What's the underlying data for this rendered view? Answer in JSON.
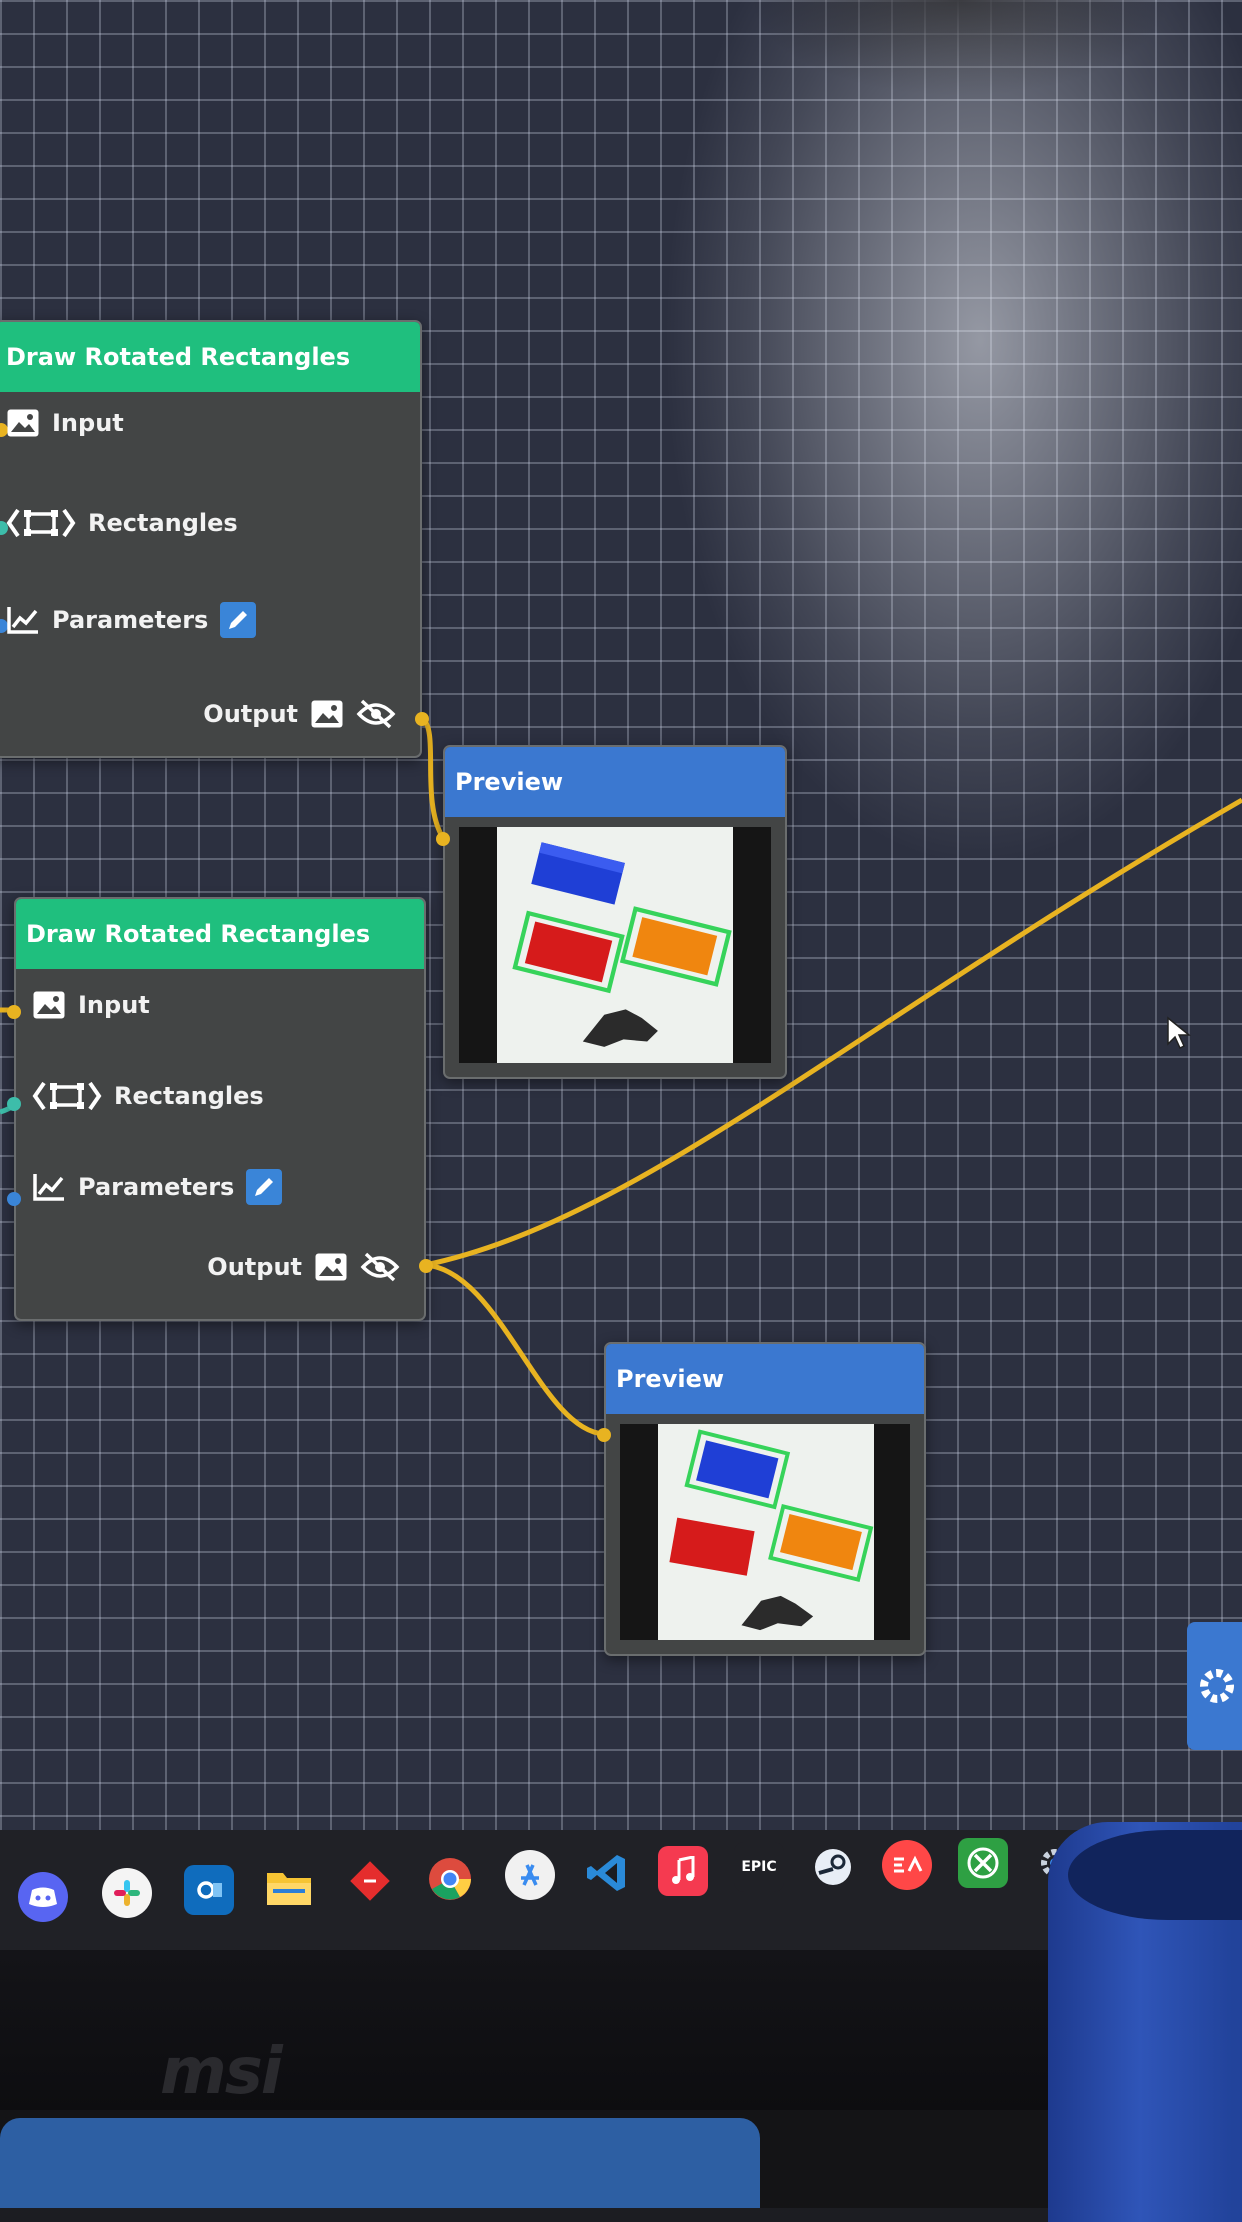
{
  "canvas": {
    "grid_color": "#cdd4e6",
    "background_color": "#2c3040",
    "edge_color": "#e8b321"
  },
  "nodes": [
    {
      "title": "Draw Rotated Rectangles",
      "header_color": "#1fbf7e",
      "inputs": [
        {
          "label": "Input",
          "icon": "image-icon"
        },
        {
          "label": "Rectangles",
          "icon": "rectangle-list-icon"
        },
        {
          "label": "Parameters",
          "icon": "chart-line-icon",
          "edit_icon": "pencil-icon"
        }
      ],
      "output": {
        "label": "Output",
        "icons": [
          "image-icon",
          "eye-off-icon"
        ]
      }
    },
    {
      "title": "Draw Rotated Rectangles",
      "header_color": "#1fbf7e",
      "inputs": [
        {
          "label": "Input",
          "icon": "image-icon"
        },
        {
          "label": "Rectangles",
          "icon": "rectangle-list-icon"
        },
        {
          "label": "Parameters",
          "icon": "chart-line-icon",
          "edit_icon": "pencil-icon"
        }
      ],
      "output": {
        "label": "Output",
        "icons": [
          "image-icon",
          "eye-off-icon"
        ]
      }
    }
  ],
  "previews": [
    {
      "title": "Preview",
      "header_color": "#3b78d0",
      "content": "preview-image"
    },
    {
      "title": "Preview",
      "header_color": "#3b78d0",
      "content": "preview-image"
    }
  ],
  "side_panel": {
    "icon": "gear-icon",
    "color": "#3b78d0"
  },
  "taskbar": {
    "icons": [
      "discord-icon",
      "slack-icon",
      "outlook-icon",
      "file-explorer-icon",
      "git-icon",
      "chrome-icon",
      "app-store-icon",
      "vscode-icon",
      "music-icon",
      "epic-games-icon",
      "steam-icon",
      "ea-icon",
      "xbox-icon",
      "settings-icon"
    ],
    "epic_label": "EPIC"
  },
  "monitor": {
    "brand": "msi"
  }
}
